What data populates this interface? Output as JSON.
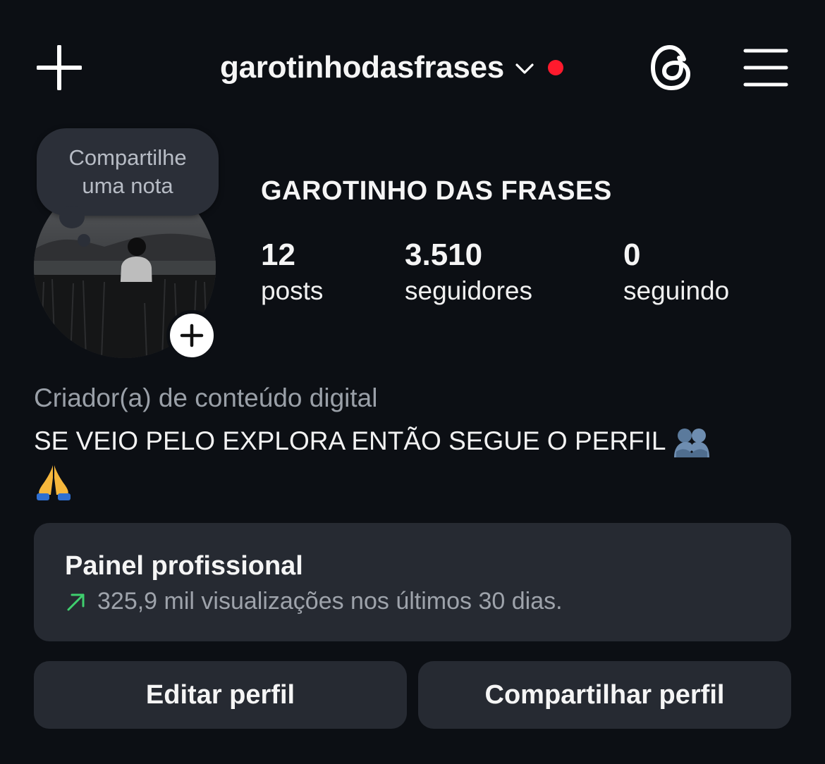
{
  "header": {
    "username": "garotinhodasfrases",
    "notification_color": "#ff1a2d"
  },
  "icons": {
    "create": "plus-icon",
    "account_switch": "chevron-down-icon",
    "threads": "threads-icon",
    "menu": "hamburger-menu-icon",
    "add_story": "plus-icon",
    "trend": "trend-up-arrow-icon"
  },
  "profile": {
    "note_line1": "Compartilhe",
    "note_line2": "uma nota",
    "display_name": "GAROTINHO DAS FRASES",
    "stats": [
      {
        "value": "12",
        "label": "posts"
      },
      {
        "value": "3.510",
        "label": "seguidores"
      },
      {
        "value": "0",
        "label": "seguindo"
      }
    ]
  },
  "bio": {
    "category": "Criador(a) de conteúdo digital",
    "text": "SE VEIO PELO EXPLORA ENTÃO SEGUE O PERFIL",
    "emojis": [
      "people-hugging-emoji",
      "folded-hands-emoji"
    ]
  },
  "professional_panel": {
    "title": "Painel profissional",
    "stats_text": "325,9 mil visualizações nos últimos 30 dias.",
    "accent_color": "#3fcf6e"
  },
  "actions": {
    "edit_label": "Editar perfil",
    "share_label": "Compartilhar perfil"
  }
}
